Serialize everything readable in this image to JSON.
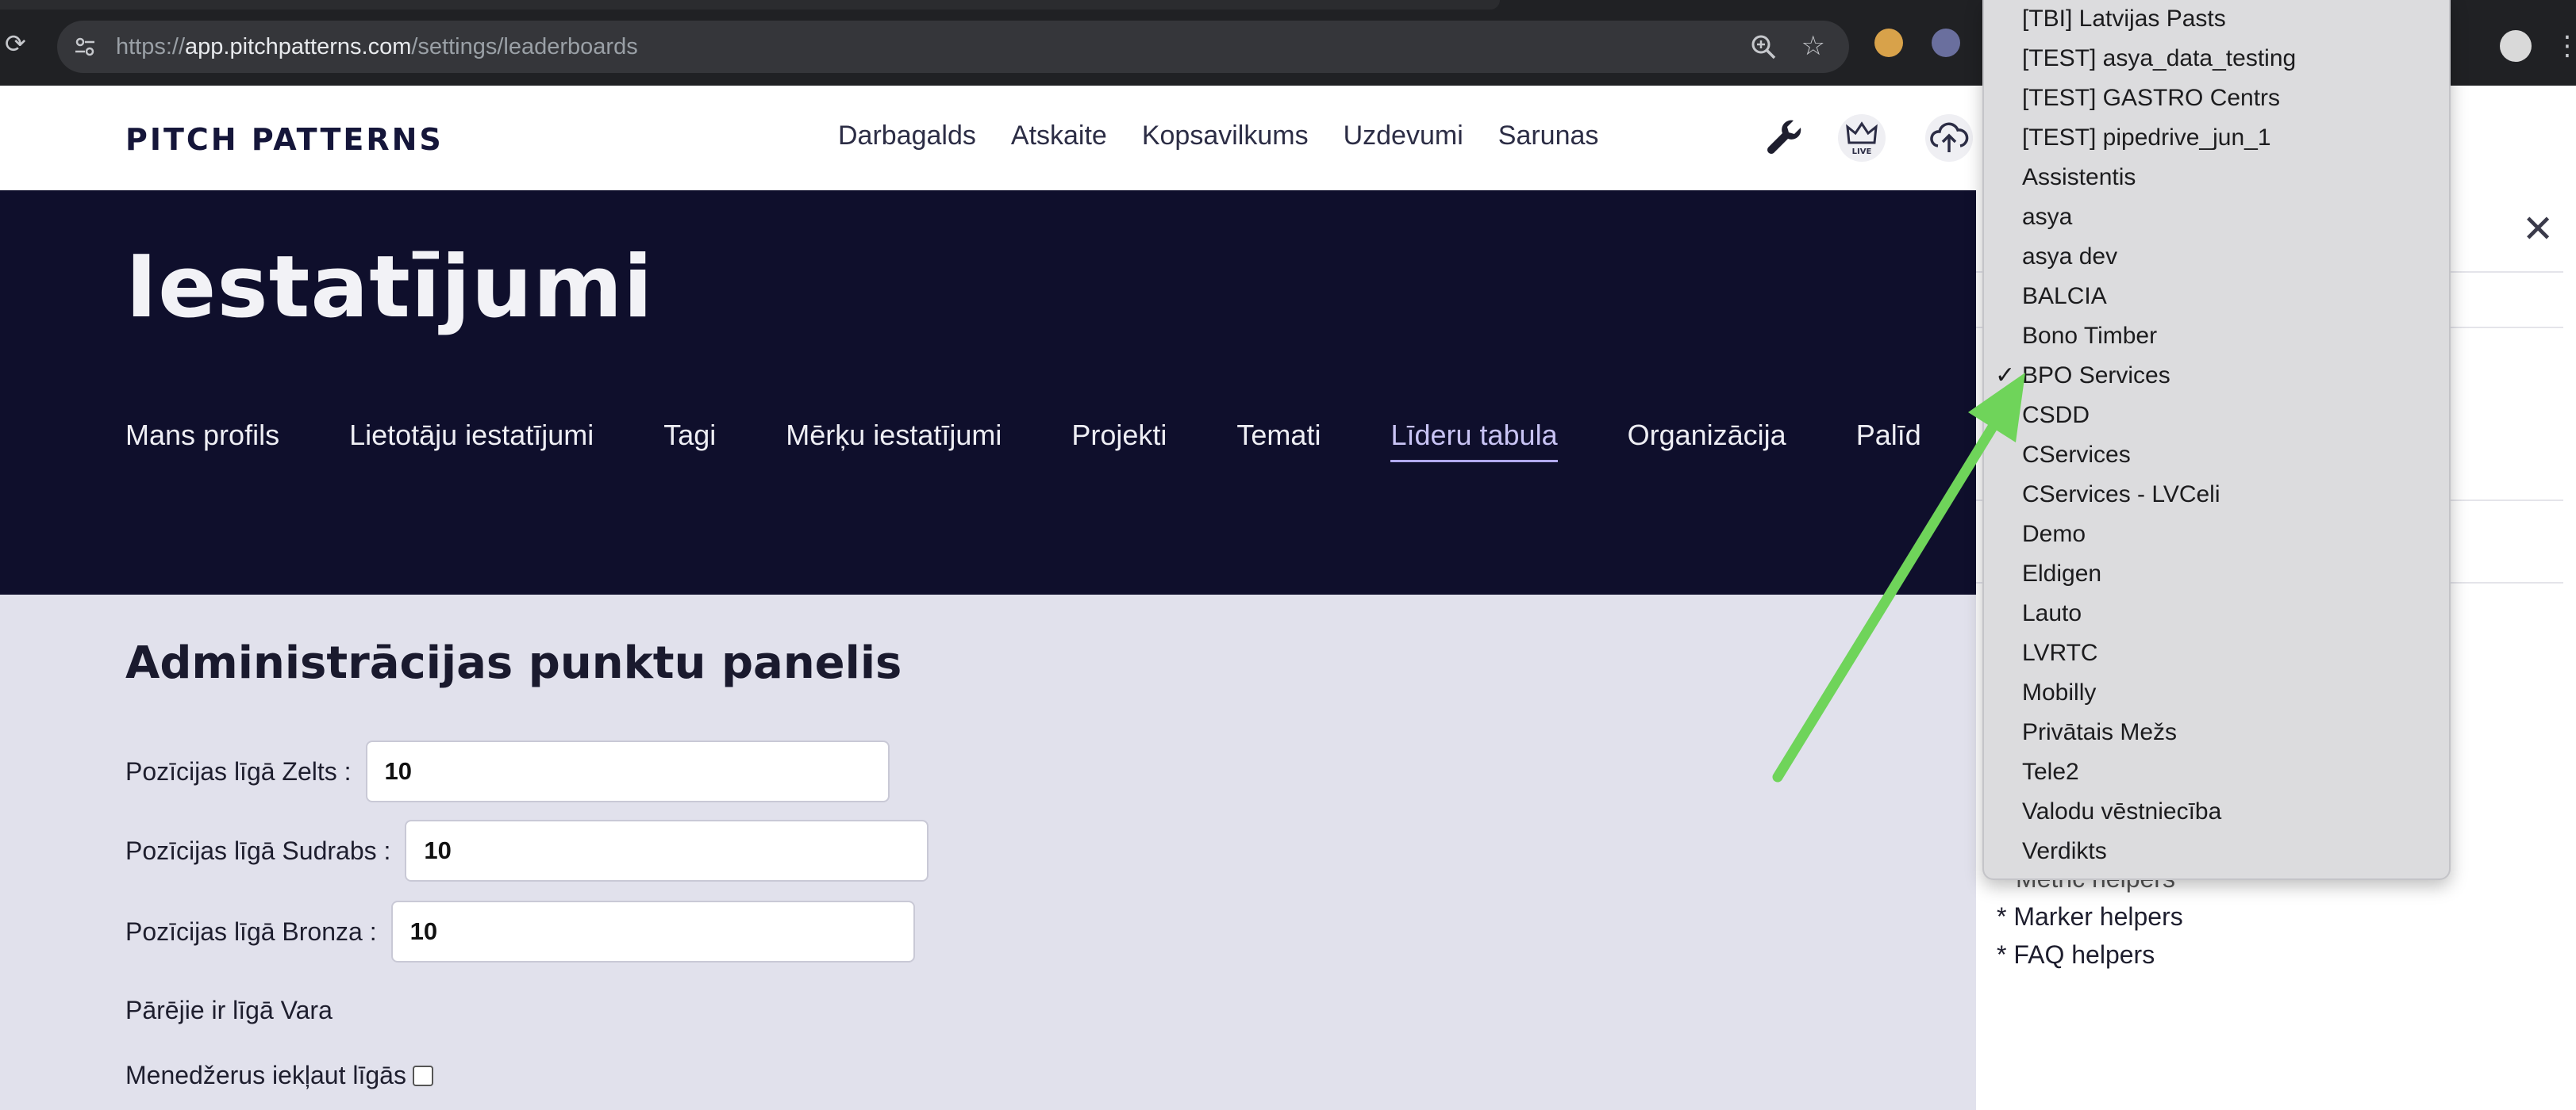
{
  "browser": {
    "url_scheme": "https://",
    "url_host": "app.pitchpatterns.com",
    "url_path": "/settings/leaderboards"
  },
  "header": {
    "logo": "PITCH PATTERNS",
    "nav": [
      "Darbagalds",
      "Atskaite",
      "Kopsavilkums",
      "Uzdevumi",
      "Sarunas"
    ],
    "live_badge": "LIVE"
  },
  "hero": {
    "title": "Iestatījumi",
    "tabs": [
      "Mans profils",
      "Lietotāju iestatījumi",
      "Tagi",
      "Mērķu iestatījumi",
      "Projekti",
      "Temati",
      "Līderu tabula",
      "Organizācija",
      "Palīd"
    ],
    "active_tab": "Līderu tabula"
  },
  "panel": {
    "title": "Administrācijas punktu panelis",
    "gold_label": "Pozīcijas līgā Zelts :",
    "gold_value": "10",
    "silver_label": "Pozīcijas līgā Sudrabs :",
    "silver_value": "10",
    "bronze_label": "Pozīcijas līgā Bronza :",
    "bronze_value": "10",
    "others_text": "Pārējie ir līgā Vara",
    "managers_label": "Menedžerus iekļaut līgās"
  },
  "side_panel": {
    "helpers": [
      "Metric helpers",
      "* Marker helpers",
      "* FAQ helpers"
    ]
  },
  "dropdown": {
    "selected": "BPO Services",
    "check_glyph": "✓",
    "options": [
      "[TBI] Latvijas Pasts",
      "[TEST] asya_data_testing",
      "[TEST] GASTRO Centrs",
      "[TEST] pipedrive_jun_1",
      "Assistentis",
      "asya",
      "asya dev",
      "BALCIA",
      "Bono Timber",
      "BPO Services",
      "CSDD",
      "CServices",
      "CServices - LVCeli",
      "Demo",
      "Eldigen",
      "Lauto",
      "LVRTC",
      "Mobilly",
      "Privātais Mežs",
      "Tele2",
      "Valodu vēstniecība",
      "Verdikts"
    ]
  },
  "icons": {
    "reload": "reload-icon",
    "tune": "site-settings-icon",
    "zoom": "zoom-icon",
    "star": "bookmark-star-icon",
    "wrench": "wrench-icon",
    "crown": "crown-live-icon",
    "upload": "cloud-upload-icon",
    "close": "close-icon"
  },
  "colors": {
    "hero_bg": "#0f0f2c",
    "content_bg": "#e1e1ec",
    "active_tab": "#c8c3f4",
    "annotation_arrow": "#6fd45a"
  }
}
